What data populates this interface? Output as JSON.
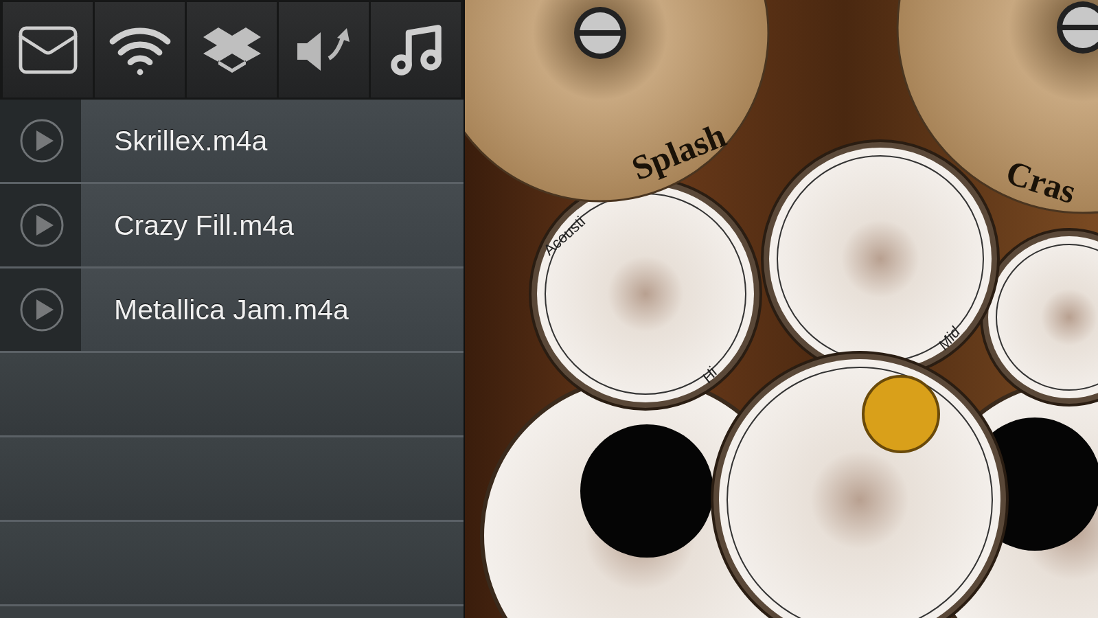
{
  "toolbar": [
    {
      "kind": "mail"
    },
    {
      "kind": "wifi"
    },
    {
      "kind": "dropbox"
    },
    {
      "kind": "speaker"
    },
    {
      "kind": "music"
    }
  ],
  "recordings": [
    {
      "name": "Skrillex.m4a"
    },
    {
      "name": "Crazy Fill.m4a"
    },
    {
      "name": "Metallica Jam.m4a"
    }
  ],
  "drums": [
    {
      "kind": "cymbal",
      "label": "Splash"
    },
    {
      "kind": "cymbal",
      "label": "Cras"
    },
    {
      "kind": "tom",
      "label": "Hi",
      "brand": "Acousti"
    },
    {
      "kind": "tom",
      "label": "Mid"
    },
    {
      "kind": "tom"
    },
    {
      "kind": "bass"
    },
    {
      "kind": "bass"
    },
    {
      "kind": "snare"
    }
  ]
}
